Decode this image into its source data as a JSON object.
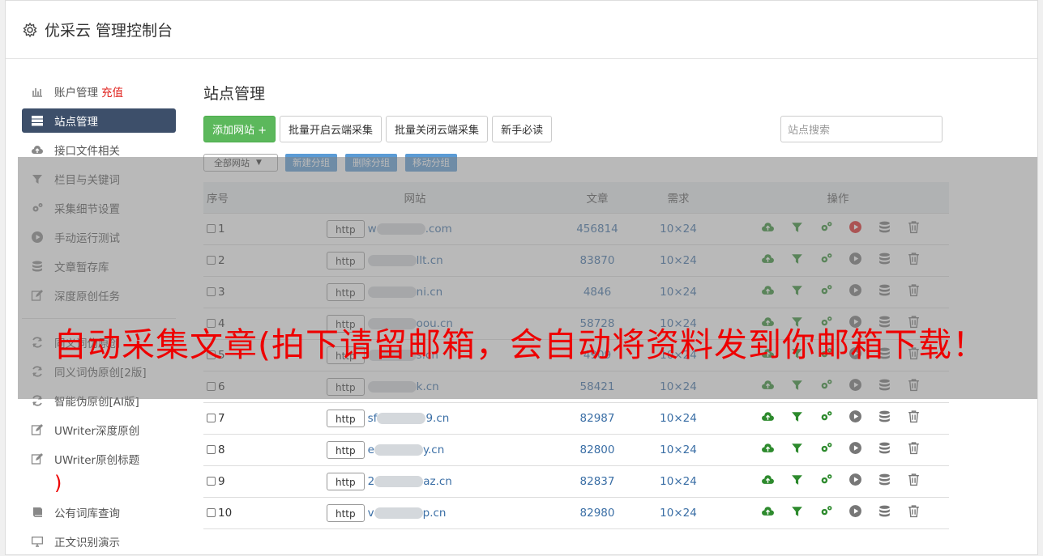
{
  "app": {
    "title": "优采云 管理控制台"
  },
  "sidebar": {
    "items": [
      {
        "label": "账户管理",
        "extra": "充值",
        "icon": "bar-chart-icon"
      },
      {
        "label": "站点管理",
        "icon": "server-icon",
        "active": true
      },
      {
        "label": "接口文件相关",
        "icon": "cloud-upload-icon"
      },
      {
        "label": "栏目与关键词",
        "icon": "filter-icon"
      },
      {
        "label": "采集细节设置",
        "icon": "cogs-icon"
      },
      {
        "label": "手动运行测试",
        "icon": "play-circle-icon"
      },
      {
        "label": "文章暂存库",
        "icon": "database-icon"
      },
      {
        "label": "深度原创任务",
        "icon": "edit-icon"
      }
    ],
    "items2": [
      {
        "label": "同义词伪原创",
        "icon": "refresh-icon"
      },
      {
        "label": "同义词伪原创[2版]",
        "icon": "refresh-icon"
      },
      {
        "label": "智能伪原创[AI版]",
        "icon": "refresh-icon"
      },
      {
        "label": "UWriter深度原创",
        "icon": "edit-icon"
      },
      {
        "label": "UWriter原创标题",
        "icon": "edit-icon"
      }
    ],
    "stray": ")",
    "items3": [
      {
        "label": "公有词库查询",
        "icon": "book-icon"
      },
      {
        "label": "正文识别演示",
        "icon": "monitor-icon"
      }
    ]
  },
  "main": {
    "title": "站点管理",
    "buttons": {
      "add": "添加网站 +",
      "batch_open": "批量开启云端采集",
      "batch_close": "批量关闭云端采集",
      "guide": "新手必读"
    },
    "search_placeholder": "站点搜索",
    "group_select": "全部网站",
    "group_buttons": {
      "new": "新建分组",
      "delete": "删除分组",
      "move": "移动分组"
    },
    "table": {
      "headers": {
        "num": "序号",
        "site": "网站",
        "articles": "文章",
        "demand": "需求",
        "ops": "操作"
      },
      "rows": [
        {
          "num": "1",
          "prefix": "w",
          "suffix": ".com",
          "articles": "456814",
          "demand": "10×24",
          "play_active": true
        },
        {
          "num": "2",
          "prefix": "",
          "suffix": "llt.cn",
          "articles": "83870",
          "demand": "10×24",
          "play_active": false
        },
        {
          "num": "3",
          "prefix": "",
          "suffix": "ni.cn",
          "articles": "4846",
          "demand": "10×24",
          "play_active": false
        },
        {
          "num": "4",
          "prefix": "",
          "suffix": "oou.cn",
          "articles": "58728",
          "demand": "10×24",
          "play_active": false
        },
        {
          "num": "5",
          "prefix": "",
          "suffix": "s.cn",
          "articles": "4909",
          "demand": "10×24",
          "play_active": false
        },
        {
          "num": "6",
          "prefix": "",
          "suffix": "k.cn",
          "articles": "58421",
          "demand": "10×24",
          "play_active": false
        },
        {
          "num": "7",
          "prefix": "sf",
          "suffix": "9.cn",
          "articles": "82987",
          "demand": "10×24",
          "play_active": false
        },
        {
          "num": "8",
          "prefix": "e",
          "suffix": "y.cn",
          "articles": "82800",
          "demand": "10×24",
          "play_active": false
        },
        {
          "num": "9",
          "prefix": "2",
          "suffix": "az.cn",
          "articles": "82837",
          "demand": "10×24",
          "play_active": false
        },
        {
          "num": "10",
          "prefix": "v",
          "suffix": "p.cn",
          "articles": "82980",
          "demand": "10×24",
          "play_active": false
        }
      ],
      "http_label": "http"
    }
  },
  "banner": "自动采集文章(拍下请留邮箱，会自动将资料发到你邮箱下载！",
  "colors": {
    "sidebar_active": "#3d4f6a",
    "green": "#5cb85c",
    "link": "#3a6ea5",
    "banner": "#ee0000",
    "recharge": "#e0211c"
  }
}
